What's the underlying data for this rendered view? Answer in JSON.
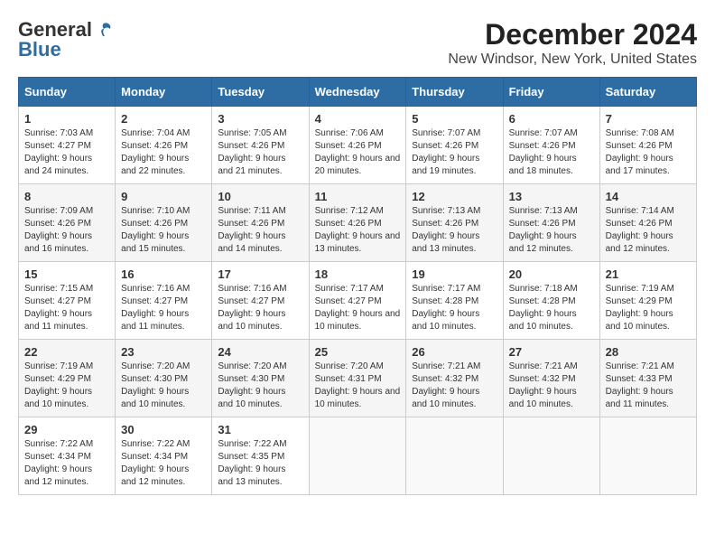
{
  "logo": {
    "line1": "General",
    "line2": "Blue"
  },
  "title": "December 2024",
  "subtitle": "New Windsor, New York, United States",
  "days_of_week": [
    "Sunday",
    "Monday",
    "Tuesday",
    "Wednesday",
    "Thursday",
    "Friday",
    "Saturday"
  ],
  "weeks": [
    [
      {
        "day": "1",
        "sunrise": "7:03 AM",
        "sunset": "4:27 PM",
        "daylight": "9 hours and 24 minutes."
      },
      {
        "day": "2",
        "sunrise": "7:04 AM",
        "sunset": "4:26 PM",
        "daylight": "9 hours and 22 minutes."
      },
      {
        "day": "3",
        "sunrise": "7:05 AM",
        "sunset": "4:26 PM",
        "daylight": "9 hours and 21 minutes."
      },
      {
        "day": "4",
        "sunrise": "7:06 AM",
        "sunset": "4:26 PM",
        "daylight": "9 hours and 20 minutes."
      },
      {
        "day": "5",
        "sunrise": "7:07 AM",
        "sunset": "4:26 PM",
        "daylight": "9 hours and 19 minutes."
      },
      {
        "day": "6",
        "sunrise": "7:07 AM",
        "sunset": "4:26 PM",
        "daylight": "9 hours and 18 minutes."
      },
      {
        "day": "7",
        "sunrise": "7:08 AM",
        "sunset": "4:26 PM",
        "daylight": "9 hours and 17 minutes."
      }
    ],
    [
      {
        "day": "8",
        "sunrise": "7:09 AM",
        "sunset": "4:26 PM",
        "daylight": "9 hours and 16 minutes."
      },
      {
        "day": "9",
        "sunrise": "7:10 AM",
        "sunset": "4:26 PM",
        "daylight": "9 hours and 15 minutes."
      },
      {
        "day": "10",
        "sunrise": "7:11 AM",
        "sunset": "4:26 PM",
        "daylight": "9 hours and 14 minutes."
      },
      {
        "day": "11",
        "sunrise": "7:12 AM",
        "sunset": "4:26 PM",
        "daylight": "9 hours and 13 minutes."
      },
      {
        "day": "12",
        "sunrise": "7:13 AM",
        "sunset": "4:26 PM",
        "daylight": "9 hours and 13 minutes."
      },
      {
        "day": "13",
        "sunrise": "7:13 AM",
        "sunset": "4:26 PM",
        "daylight": "9 hours and 12 minutes."
      },
      {
        "day": "14",
        "sunrise": "7:14 AM",
        "sunset": "4:26 PM",
        "daylight": "9 hours and 12 minutes."
      }
    ],
    [
      {
        "day": "15",
        "sunrise": "7:15 AM",
        "sunset": "4:27 PM",
        "daylight": "9 hours and 11 minutes."
      },
      {
        "day": "16",
        "sunrise": "7:16 AM",
        "sunset": "4:27 PM",
        "daylight": "9 hours and 11 minutes."
      },
      {
        "day": "17",
        "sunrise": "7:16 AM",
        "sunset": "4:27 PM",
        "daylight": "9 hours and 10 minutes."
      },
      {
        "day": "18",
        "sunrise": "7:17 AM",
        "sunset": "4:27 PM",
        "daylight": "9 hours and 10 minutes."
      },
      {
        "day": "19",
        "sunrise": "7:17 AM",
        "sunset": "4:28 PM",
        "daylight": "9 hours and 10 minutes."
      },
      {
        "day": "20",
        "sunrise": "7:18 AM",
        "sunset": "4:28 PM",
        "daylight": "9 hours and 10 minutes."
      },
      {
        "day": "21",
        "sunrise": "7:19 AM",
        "sunset": "4:29 PM",
        "daylight": "9 hours and 10 minutes."
      }
    ],
    [
      {
        "day": "22",
        "sunrise": "7:19 AM",
        "sunset": "4:29 PM",
        "daylight": "9 hours and 10 minutes."
      },
      {
        "day": "23",
        "sunrise": "7:20 AM",
        "sunset": "4:30 PM",
        "daylight": "9 hours and 10 minutes."
      },
      {
        "day": "24",
        "sunrise": "7:20 AM",
        "sunset": "4:30 PM",
        "daylight": "9 hours and 10 minutes."
      },
      {
        "day": "25",
        "sunrise": "7:20 AM",
        "sunset": "4:31 PM",
        "daylight": "9 hours and 10 minutes."
      },
      {
        "day": "26",
        "sunrise": "7:21 AM",
        "sunset": "4:32 PM",
        "daylight": "9 hours and 10 minutes."
      },
      {
        "day": "27",
        "sunrise": "7:21 AM",
        "sunset": "4:32 PM",
        "daylight": "9 hours and 10 minutes."
      },
      {
        "day": "28",
        "sunrise": "7:21 AM",
        "sunset": "4:33 PM",
        "daylight": "9 hours and 11 minutes."
      }
    ],
    [
      {
        "day": "29",
        "sunrise": "7:22 AM",
        "sunset": "4:34 PM",
        "daylight": "9 hours and 12 minutes."
      },
      {
        "day": "30",
        "sunrise": "7:22 AM",
        "sunset": "4:34 PM",
        "daylight": "9 hours and 12 minutes."
      },
      {
        "day": "31",
        "sunrise": "7:22 AM",
        "sunset": "4:35 PM",
        "daylight": "9 hours and 13 minutes."
      },
      null,
      null,
      null,
      null
    ]
  ]
}
